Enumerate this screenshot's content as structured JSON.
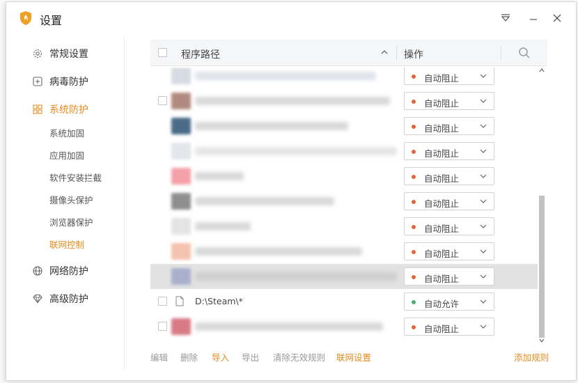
{
  "window": {
    "title": "设置"
  },
  "sidebar": {
    "general": "常规设置",
    "virus": "病毒防护",
    "system": "系统防护",
    "sub_items": [
      "系统加固",
      "应用加固",
      "软件安装拦截",
      "摄像头保护",
      "浏览器保护",
      "联网控制"
    ],
    "network": "网络防护",
    "advanced": "高级防护"
  },
  "table": {
    "col_path": "程序路径",
    "col_op": "操作",
    "rows": [
      {
        "path": "",
        "op": "自动阻止",
        "status": "block"
      },
      {
        "path": "",
        "op": "自动阻止",
        "status": "block"
      },
      {
        "path": "",
        "op": "自动阻止",
        "status": "block"
      },
      {
        "path": "",
        "op": "自动阻止",
        "status": "block"
      },
      {
        "path": "",
        "op": "自动阻止",
        "status": "block"
      },
      {
        "path": "",
        "op": "自动阻止",
        "status": "block"
      },
      {
        "path": "",
        "op": "自动阻止",
        "status": "block"
      },
      {
        "path": "",
        "op": "自动阻止",
        "status": "block"
      },
      {
        "path": "",
        "op": "自动阻止",
        "status": "block",
        "selected": true
      },
      {
        "path": "D:\\Steam\\*",
        "op": "自动允许",
        "status": "allow"
      },
      {
        "path": "",
        "op": "自动阻止",
        "status": "block"
      }
    ]
  },
  "footer": {
    "edit": "编辑",
    "delete": "删除",
    "import": "导入",
    "export": "导出",
    "clear_invalid": "清除无效规则",
    "network_settings": "联网设置",
    "add_rule": "添加规则"
  },
  "colors": {
    "accent": "#e58d22",
    "block": "#e8613a",
    "allow": "#4caf6e"
  }
}
